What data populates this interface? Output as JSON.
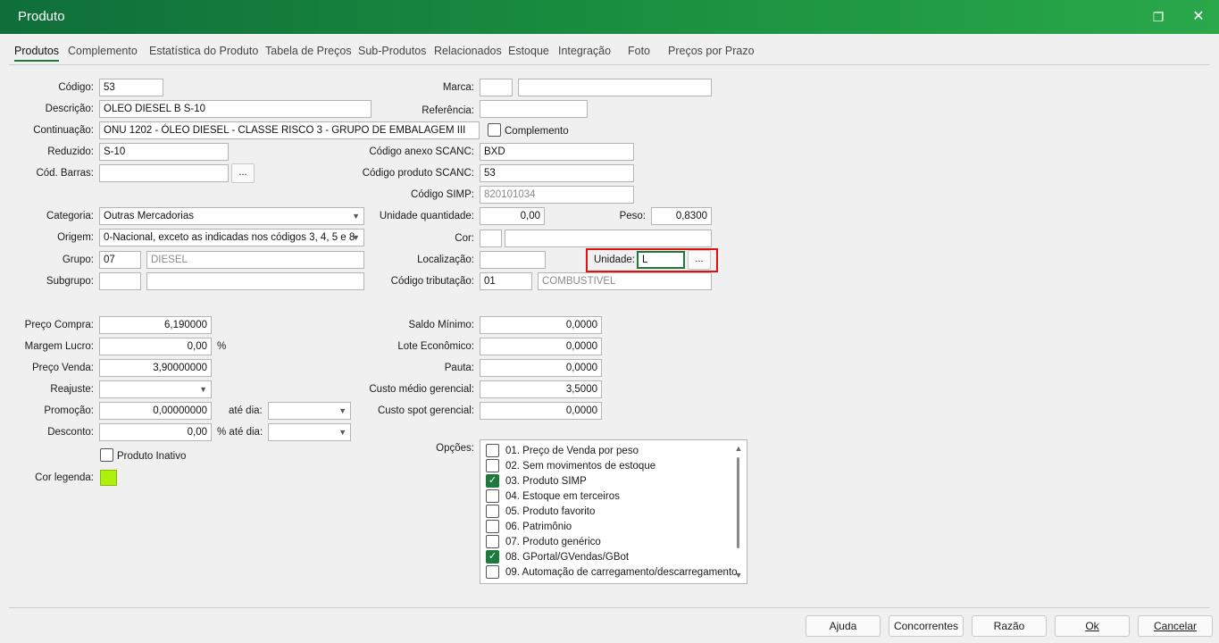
{
  "window": {
    "title": "Produto",
    "restore_icon": "restore-icon",
    "close_icon": "close-icon"
  },
  "tabs": [
    "Produtos",
    "Complemento",
    "Estatística do Produto",
    "Tabela de Preços",
    "Sub-Produtos",
    "Relacionados",
    "Estoque",
    "Integração",
    "Foto",
    "Preços por Prazo"
  ],
  "form": {
    "codigo": {
      "label": "Código:",
      "value": "53"
    },
    "descricao": {
      "label": "Descrição:",
      "value": "OLEO DIESEL B S-10"
    },
    "continuacao": {
      "label": "Continuação:",
      "value": "ONU 1202 - ÓLEO DIESEL - CLASSE RISCO 3 - GRUPO DE EMBALAGEM III"
    },
    "complemento": {
      "label": "Complemento",
      "checked": false
    },
    "reduzido": {
      "label": "Reduzido:",
      "value": "S-10"
    },
    "cod_barras": {
      "label": "Cód. Barras:",
      "value": "",
      "button": "..."
    },
    "marca": {
      "label": "Marca:",
      "value1": "",
      "value2": ""
    },
    "referencia": {
      "label": "Referência:",
      "value": ""
    },
    "codigo_anexo": {
      "label": "Código anexo SCANC:",
      "value": "BXD"
    },
    "codigo_produto_scanc": {
      "label": "Código produto SCANC:",
      "value": "53"
    },
    "codigo_simp": {
      "label": "Código SIMP:",
      "value": "820101034"
    },
    "categoria": {
      "label": "Categoria:",
      "value": "Outras Mercadorias"
    },
    "origem": {
      "label": "Origem:",
      "value": "0-Nacional, exceto as indicadas nos códigos 3, 4, 5 e 8"
    },
    "grupo": {
      "label": "Grupo:",
      "code": "07",
      "name": "DIESEL"
    },
    "subgrupo": {
      "label": "Subgrupo:",
      "code": "",
      "name": ""
    },
    "unidade_quantidade": {
      "label": "Unidade quantidade:",
      "value": "0,00"
    },
    "peso": {
      "label": "Peso:",
      "value": "0,8300"
    },
    "cor": {
      "label": "Cor:",
      "value1": "",
      "value2": ""
    },
    "localizacao": {
      "label": "Localização:",
      "value": ""
    },
    "unidade": {
      "label": "Unidade:",
      "value": "L",
      "button": "..."
    },
    "codigo_tributacao": {
      "label": "Código tributação:",
      "code": "01",
      "name": "COMBUSTIVEL"
    },
    "preco_compra": {
      "label": "Preço Compra:",
      "value": "6,190000"
    },
    "margem_lucro": {
      "label": "Margem Lucro:",
      "value": "0,00",
      "unit": "%"
    },
    "preco_venda": {
      "label": "Preço Venda:",
      "value": "3,90000000"
    },
    "reajuste": {
      "label": "Reajuste:",
      "value": ""
    },
    "promocao": {
      "label": "Promoção:",
      "value": "0,00000000",
      "ate_dia_label": "até dia:",
      "ate_dia": ""
    },
    "desconto": {
      "label": "Desconto:",
      "value": "0,00",
      "ate_dia_label": "% até dia:",
      "ate_dia": ""
    },
    "produto_inativo": {
      "label": "Produto Inativo",
      "checked": false
    },
    "cor_legenda": {
      "label": "Cor legenda:",
      "color": "#aef10a"
    },
    "saldo_minimo": {
      "label": "Saldo Mínimo:",
      "value": "0,0000"
    },
    "lote_economico": {
      "label": "Lote Econômico:",
      "value": "0,0000"
    },
    "pauta": {
      "label": "Pauta:",
      "value": "0,0000"
    },
    "custo_medio": {
      "label": "Custo médio gerencial:",
      "value": "3,5000"
    },
    "custo_spot": {
      "label": "Custo spot gerencial:",
      "value": "0,0000"
    },
    "opcoes_label": "Opções:"
  },
  "opcoes": [
    {
      "label": "01. Preço de Venda por peso",
      "checked": false
    },
    {
      "label": "02. Sem movimentos de estoque",
      "checked": false
    },
    {
      "label": "03. Produto SIMP",
      "checked": true
    },
    {
      "label": "04. Estoque em terceiros",
      "checked": false
    },
    {
      "label": "05. Produto favorito",
      "checked": false
    },
    {
      "label": "06. Patrimônio",
      "checked": false
    },
    {
      "label": "07. Produto genérico",
      "checked": false
    },
    {
      "label": "08. GPortal/GVendas/GBot",
      "checked": true
    },
    {
      "label": "09. Automação de carregamento/descarregamento",
      "checked": false
    }
  ],
  "footer": {
    "ajuda": "Ajuda",
    "concorrentes": "Concorrentes",
    "razao": "Razão",
    "ok": "Ok",
    "cancelar": "Cancelar"
  },
  "colors": {
    "title_bar": "#1b9140",
    "accent": "#1e7a3c",
    "highlight": "#e01010"
  }
}
